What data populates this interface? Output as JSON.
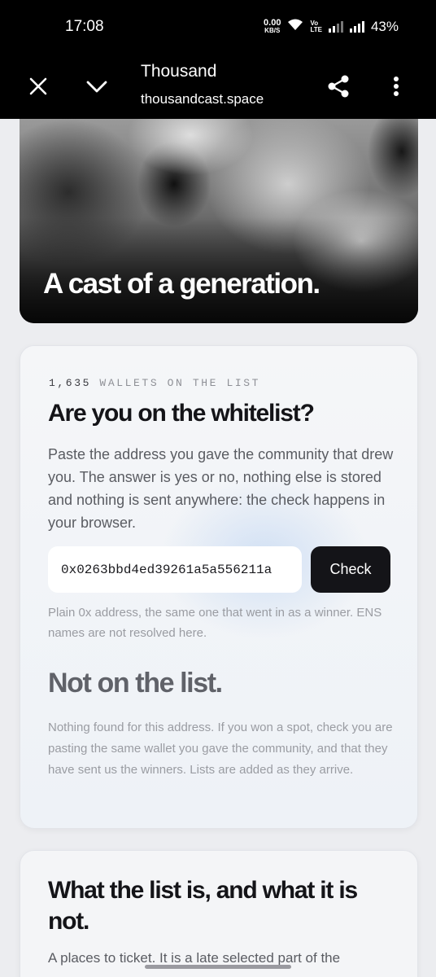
{
  "status_bar": {
    "time": "17:08",
    "net_speed_value": "0.00",
    "net_speed_unit": "KB/S",
    "volte_top": "Vo",
    "volte_bottom": "LTE",
    "battery": "43%",
    "icons": [
      "wifi-icon",
      "signal-icon",
      "signal-icon"
    ]
  },
  "browser": {
    "title": "Thousand",
    "url": "thousandcast.space",
    "icons": [
      "close-icon",
      "chevron-down-icon",
      "share-icon",
      "more-vert-icon"
    ]
  },
  "hero": {
    "headline": "A cast of a generation."
  },
  "check_card": {
    "count": "1,635",
    "eyebrow": "WALLETS ON THE LIST",
    "heading": "Are you on the whitelist?",
    "lead": "Paste the address you gave the community that drew you. The answer is yes or no, nothing else is stored and nothing is sent anywhere: the check happens in your browser.",
    "address_value": "0x0263bbd4ed39261a5a556211a",
    "check_label": "Check",
    "hint": "Plain 0x address, the same one that went in as a winner. ENS names are not resolved here.",
    "result_title": "Not on the list.",
    "result_text": "Nothing found for this address. If you won a spot, check you are pasting the same wallet you gave the community, and that they have sent us the winners. Lists are added as they arrive."
  },
  "info_card": {
    "heading": "What the list is, and what it is not.",
    "cut_text": "A places to ticket. It is a late selected part of the"
  }
}
